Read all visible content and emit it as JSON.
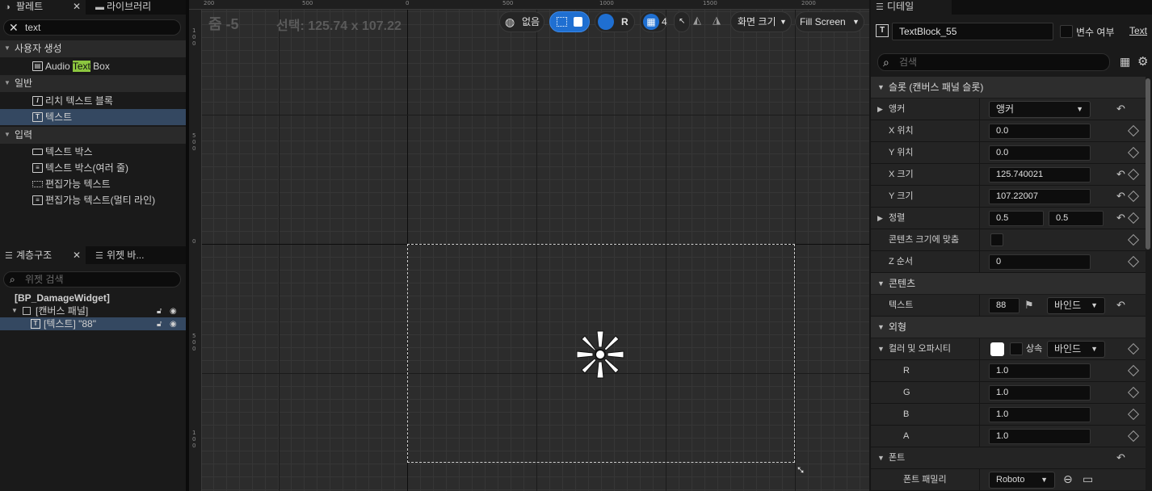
{
  "palette": {
    "tab_label": "팔레트",
    "library_tab_label": "라이브러리",
    "search_value": "text",
    "categories": [
      {
        "label": "사용자 생성",
        "items": [
          {
            "prefix": "Audio ",
            "match": "Text",
            "suffix": " Box"
          }
        ]
      },
      {
        "label": "일반",
        "items": [
          {
            "label": "리치 텍스트 블록"
          },
          {
            "label": "텍스트"
          }
        ]
      },
      {
        "label": "입력",
        "items": [
          {
            "label": "텍스트 박스"
          },
          {
            "label": "텍스트 박스(여러 줄)"
          },
          {
            "label": "편집가능 텍스트"
          },
          {
            "label": "편집가능 텍스트(멀티 라인)"
          }
        ]
      }
    ]
  },
  "hierarchy": {
    "tab_label": "계층구조",
    "widget_tab_label": "위젯 바...",
    "search_placeholder": "위젯 검색",
    "root": "[BP_DamageWidget]",
    "items": [
      {
        "label": "[캔버스 패널]"
      },
      {
        "label": "[텍스트] \"88\""
      }
    ]
  },
  "viewport": {
    "zoom_label": "줌 -5",
    "selection_label": "선택: 125.74 x 107.22",
    "language_label": "없음",
    "r_label": "R",
    "grid_value": "4",
    "screen_size_label": "화면 크기",
    "fill_screen_label": "Fill Screen",
    "ruler_top": [
      "200",
      "500",
      "0",
      "500",
      "1000",
      "1500",
      "2000"
    ],
    "ruler_left": [
      "1\n0\n0",
      "5\n0\n0",
      "0",
      "5\n0\n0",
      "1\n0\n0"
    ]
  },
  "details": {
    "tab_label": "디테일",
    "widget_name": "TextBlock_55",
    "is_variable_label": "변수 여부",
    "text_link": "Text",
    "search_placeholder": "검색",
    "slot_section": "슬롯 (캔버스 패널 슬롯)",
    "anchor_label": "앵커",
    "anchor_value": "앵커",
    "x_pos_label": "X 위치",
    "x_pos_value": "0.0",
    "y_pos_label": "Y 위치",
    "y_pos_value": "0.0",
    "x_size_label": "X 크기",
    "x_size_value": "125.740021",
    "y_size_label": "Y 크기",
    "y_size_value": "107.22007",
    "align_label": "정렬",
    "align_x": "0.5",
    "align_y": "0.5",
    "fit_content_label": "콘텐츠 크기에 맞춤",
    "z_order_label": "Z 순서",
    "z_order_value": "0",
    "content_section": "콘텐츠",
    "text_label": "텍스트",
    "text_value": "88",
    "bind_label": "바인드",
    "appearance_section": "외형",
    "color_label": "컬러 및 오파시티",
    "inherit_label": "상속",
    "color_bind_label": "바인드",
    "r_label": "R",
    "r_value": "1.0",
    "g_label": "G",
    "g_value": "1.0",
    "b_label": "B",
    "b_value": "1.0",
    "a_label": "A",
    "a_value": "1.0",
    "font_section": "폰트",
    "font_family_label": "폰트 패밀리",
    "font_family_value": "Roboto"
  },
  "colors": {
    "accent_blue": "#1f6fd1",
    "selection_row": "#344861",
    "search_highlight": "#8cc63f"
  }
}
